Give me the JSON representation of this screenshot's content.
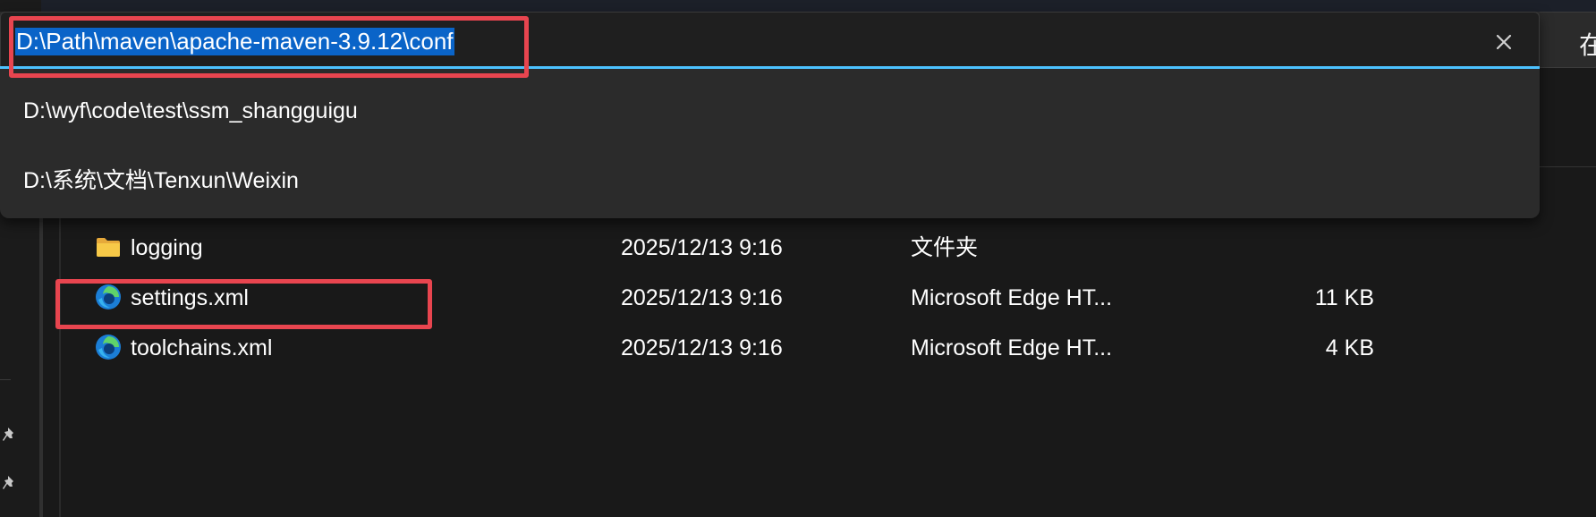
{
  "address_bar": {
    "path": "D:\\Path\\maven\\apache-maven-3.9.12\\conf"
  },
  "suggestions": [
    {
      "path": "D:\\wyf\\code\\test\\ssm_shangguigu"
    },
    {
      "path": "D:\\系统\\文档\\Tenxun\\Weixin"
    }
  ],
  "right_button": {
    "label": "在"
  },
  "files": [
    {
      "name": "logging",
      "date": "2025/12/13 9:16",
      "type": "文件夹",
      "size": "",
      "icon": "folder-icon"
    },
    {
      "name": "settings.xml",
      "date": "2025/12/13 9:16",
      "type": "Microsoft Edge HT...",
      "size": "11 KB",
      "icon": "edge-icon"
    },
    {
      "name": "toolchains.xml",
      "date": "2025/12/13 9:16",
      "type": "Microsoft Edge HT...",
      "size": "4 KB",
      "icon": "edge-icon"
    }
  ],
  "icons": {
    "clear": "close-icon",
    "pin": "pin-icon"
  },
  "colors": {
    "accent": "#4cc2ff",
    "selection": "#0a64c8",
    "highlight_box": "#e8454f",
    "folder": "#f7c948"
  }
}
